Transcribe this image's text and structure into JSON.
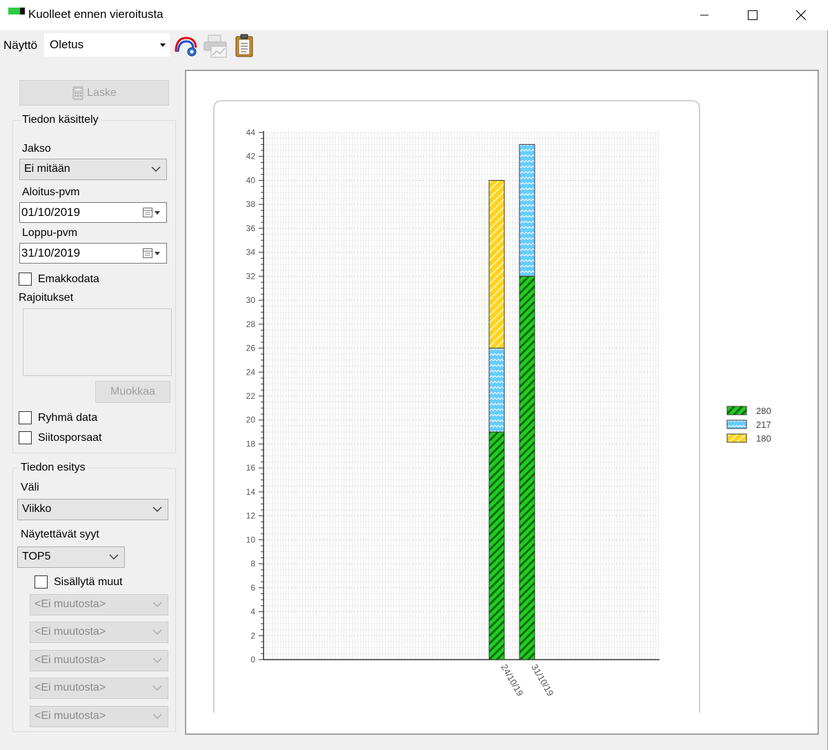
{
  "window": {
    "title": "Kuolleet ennen vieroitusta"
  },
  "toolbar": {
    "view_label": "Näyttö",
    "view_value": "Oletus"
  },
  "panel": {
    "calc_button": "Laske",
    "data_group": {
      "title": "Tiedon käsittely",
      "period_label": "Jakso",
      "period_value": "Ei mitään",
      "start_label": "Aloitus-pvm",
      "start_value": "01/10/2019",
      "end_label": "Loppu-pvm",
      "end_value": "31/10/2019",
      "sow_data_label": "Emakkodata",
      "restrictions_label": "Rajoitukset",
      "edit_button": "Muokkaa",
      "group_data_label": "Ryhmä data",
      "breeding_piglets_label": "Siitosporsaat"
    },
    "display_group": {
      "title": "Tiedon esitys",
      "interval_label": "Väli",
      "interval_value": "Viikko",
      "causes_label": "Näytettävät syyt",
      "causes_value": "TOP5",
      "include_others_label": "Sisällytä muut",
      "cause_selects": [
        "<Ei muutosta>",
        "<Ei muutosta>",
        "<Ei muutosta>",
        "<Ei muutosta>",
        "<Ei muutosta>"
      ]
    }
  },
  "chart_data": {
    "type": "bar",
    "stacked": true,
    "categories": [
      "24/10/19",
      "31/10/19"
    ],
    "series": [
      {
        "name": "280",
        "values": [
          19,
          32
        ],
        "color": "#22cc22"
      },
      {
        "name": "217",
        "values": [
          7,
          11
        ],
        "color": "#66ccff"
      },
      {
        "name": "180",
        "values": [
          14,
          0
        ],
        "color": "#ffd21f"
      }
    ],
    "ylim": [
      0,
      44
    ],
    "yticks": [
      0,
      2,
      4,
      6,
      8,
      10,
      12,
      14,
      16,
      18,
      20,
      22,
      24,
      26,
      28,
      30,
      32,
      34,
      36,
      38,
      40,
      42,
      44
    ],
    "grid": true,
    "legend": "right"
  }
}
